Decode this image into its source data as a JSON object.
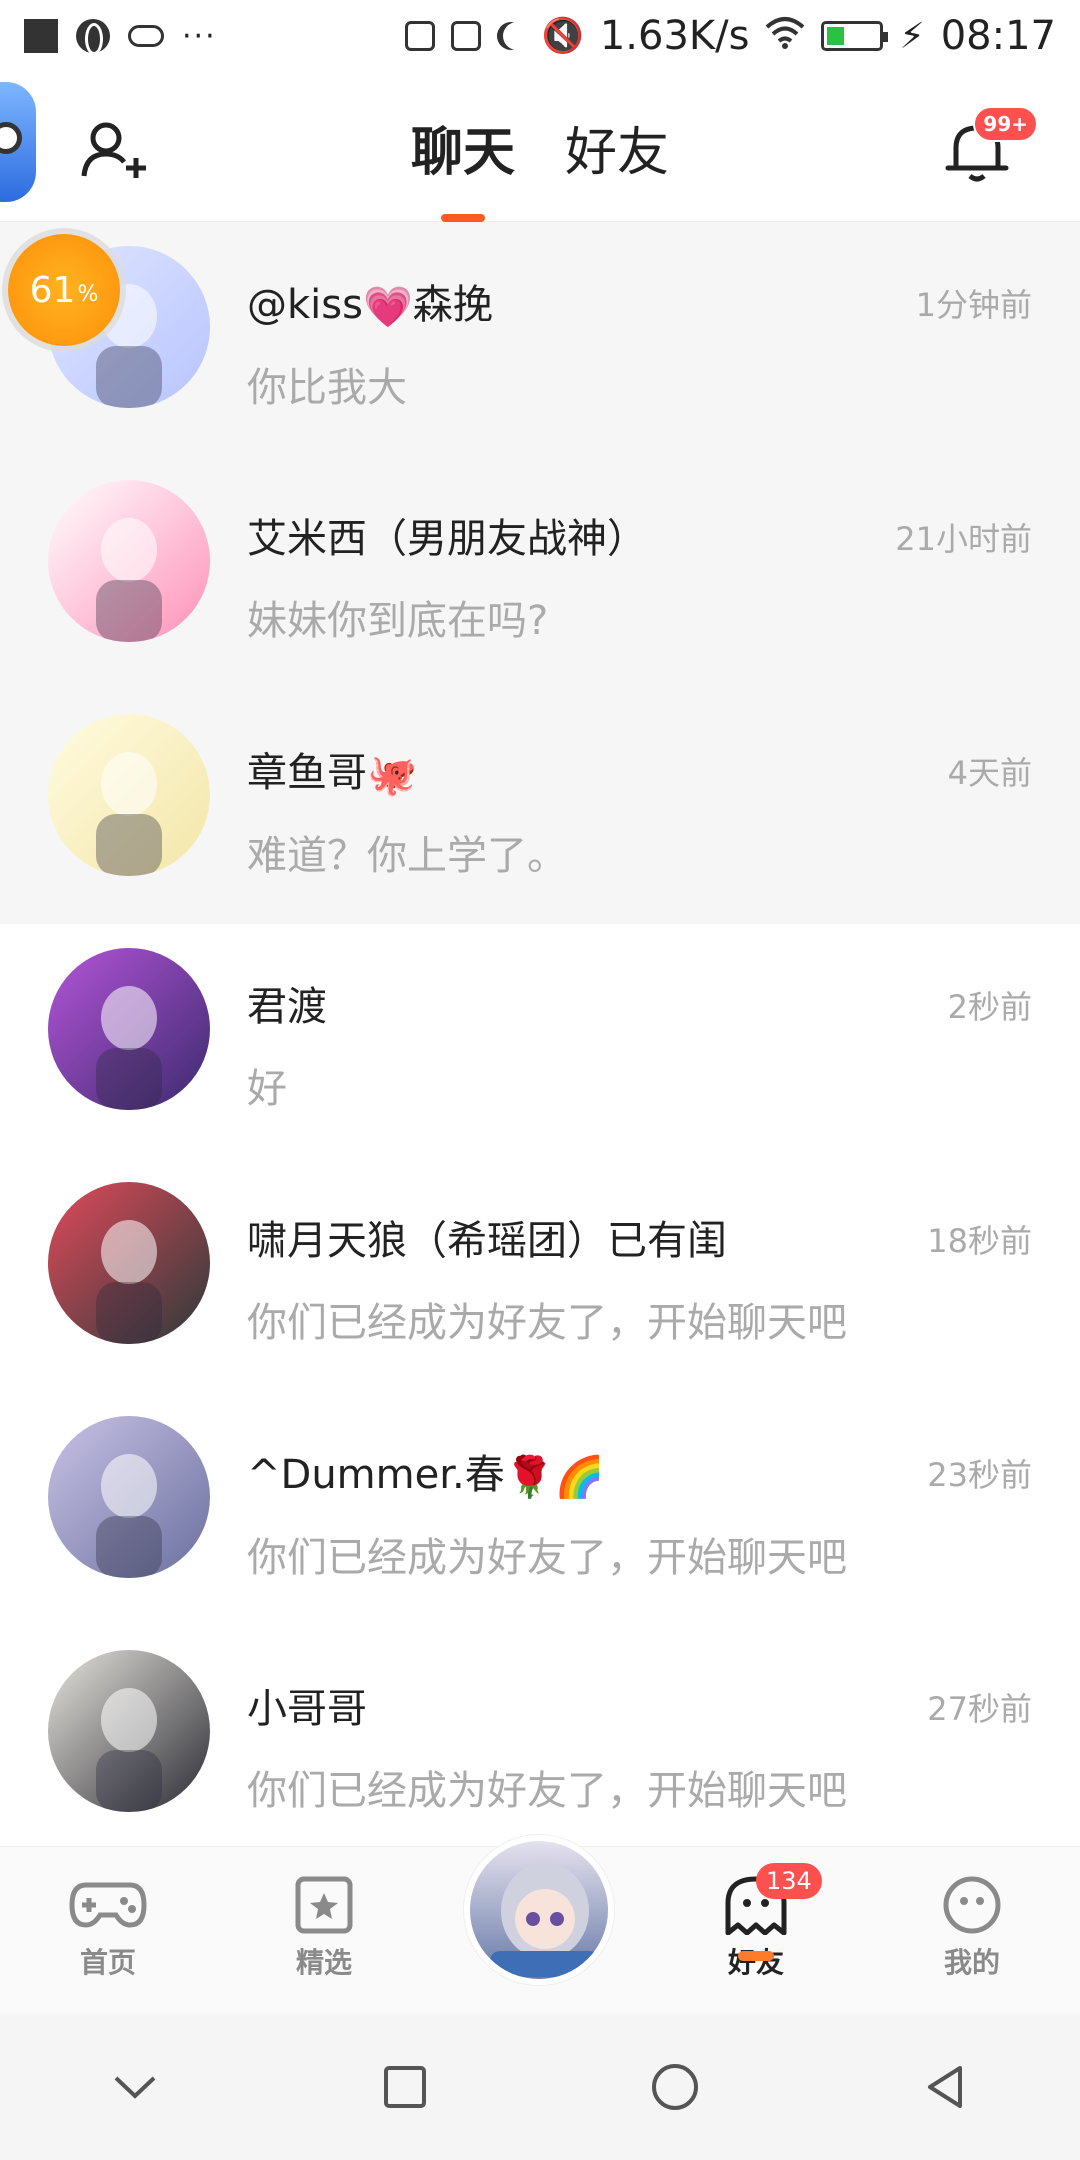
{
  "status_bar": {
    "network_speed": "1.63K/s",
    "time": "08:17",
    "battery_fraction": 0.3
  },
  "header": {
    "tabs": [
      {
        "label": "聊天",
        "active": true
      },
      {
        "label": "好友",
        "active": false
      }
    ],
    "notification_badge": "99+"
  },
  "progress_badge": {
    "value": "61",
    "unit": "%"
  },
  "chats": [
    {
      "name": "@kiss",
      "name_suffix": "森挽",
      "emoji": "💗",
      "emoji_position": "middle",
      "preview": "你比我大",
      "time": "1分钟前",
      "shaded": true,
      "avatar_colors": [
        "#dfe6ff",
        "#b8c4ff"
      ]
    },
    {
      "name": "艾米西（男朋友战神）",
      "preview": "妹妹你到底在吗?",
      "time": "21小时前",
      "shaded": true,
      "avatar_colors": [
        "#ffffff",
        "#ff8fb8"
      ]
    },
    {
      "name": "章鱼哥",
      "emoji": "🐙",
      "preview": "难道？你上学了。",
      "time": "4天前",
      "shaded": true,
      "avatar_colors": [
        "#fffbe0",
        "#f3e6a8"
      ]
    },
    {
      "name": "君渡",
      "preview": "好",
      "time": "2秒前",
      "shaded": false,
      "avatar_colors": [
        "#b455d8",
        "#3b2a6e"
      ]
    },
    {
      "name": "啸月天狼（希瑶团）已有闺",
      "preview": "你们已经成为好友了，开始聊天吧",
      "time": "18秒前",
      "shaded": false,
      "avatar_colors": [
        "#e24a5a",
        "#2a3a3a"
      ]
    },
    {
      "name": "^Dummer.春",
      "emoji": "🌹🌈",
      "preview": "你们已经成为好友了，开始聊天吧",
      "time": "23秒前",
      "shaded": false,
      "avatar_colors": [
        "#c9c3e6",
        "#6a6f9e"
      ]
    },
    {
      "name": "小哥哥",
      "preview": "你们已经成为好友了，开始聊天吧",
      "time": "27秒前",
      "shaded": false,
      "avatar_colors": [
        "#e8e5de",
        "#2b2b33"
      ]
    }
  ],
  "bottom_nav": {
    "items": [
      {
        "label": "首页"
      },
      {
        "label": "精选"
      },
      {
        "label": "好友",
        "badge": "134",
        "active": true
      },
      {
        "label": "我的"
      }
    ]
  },
  "colors": {
    "accent": "#ff5a1f",
    "badge": "#ff5050",
    "muted_text": "#aaaaaa"
  }
}
